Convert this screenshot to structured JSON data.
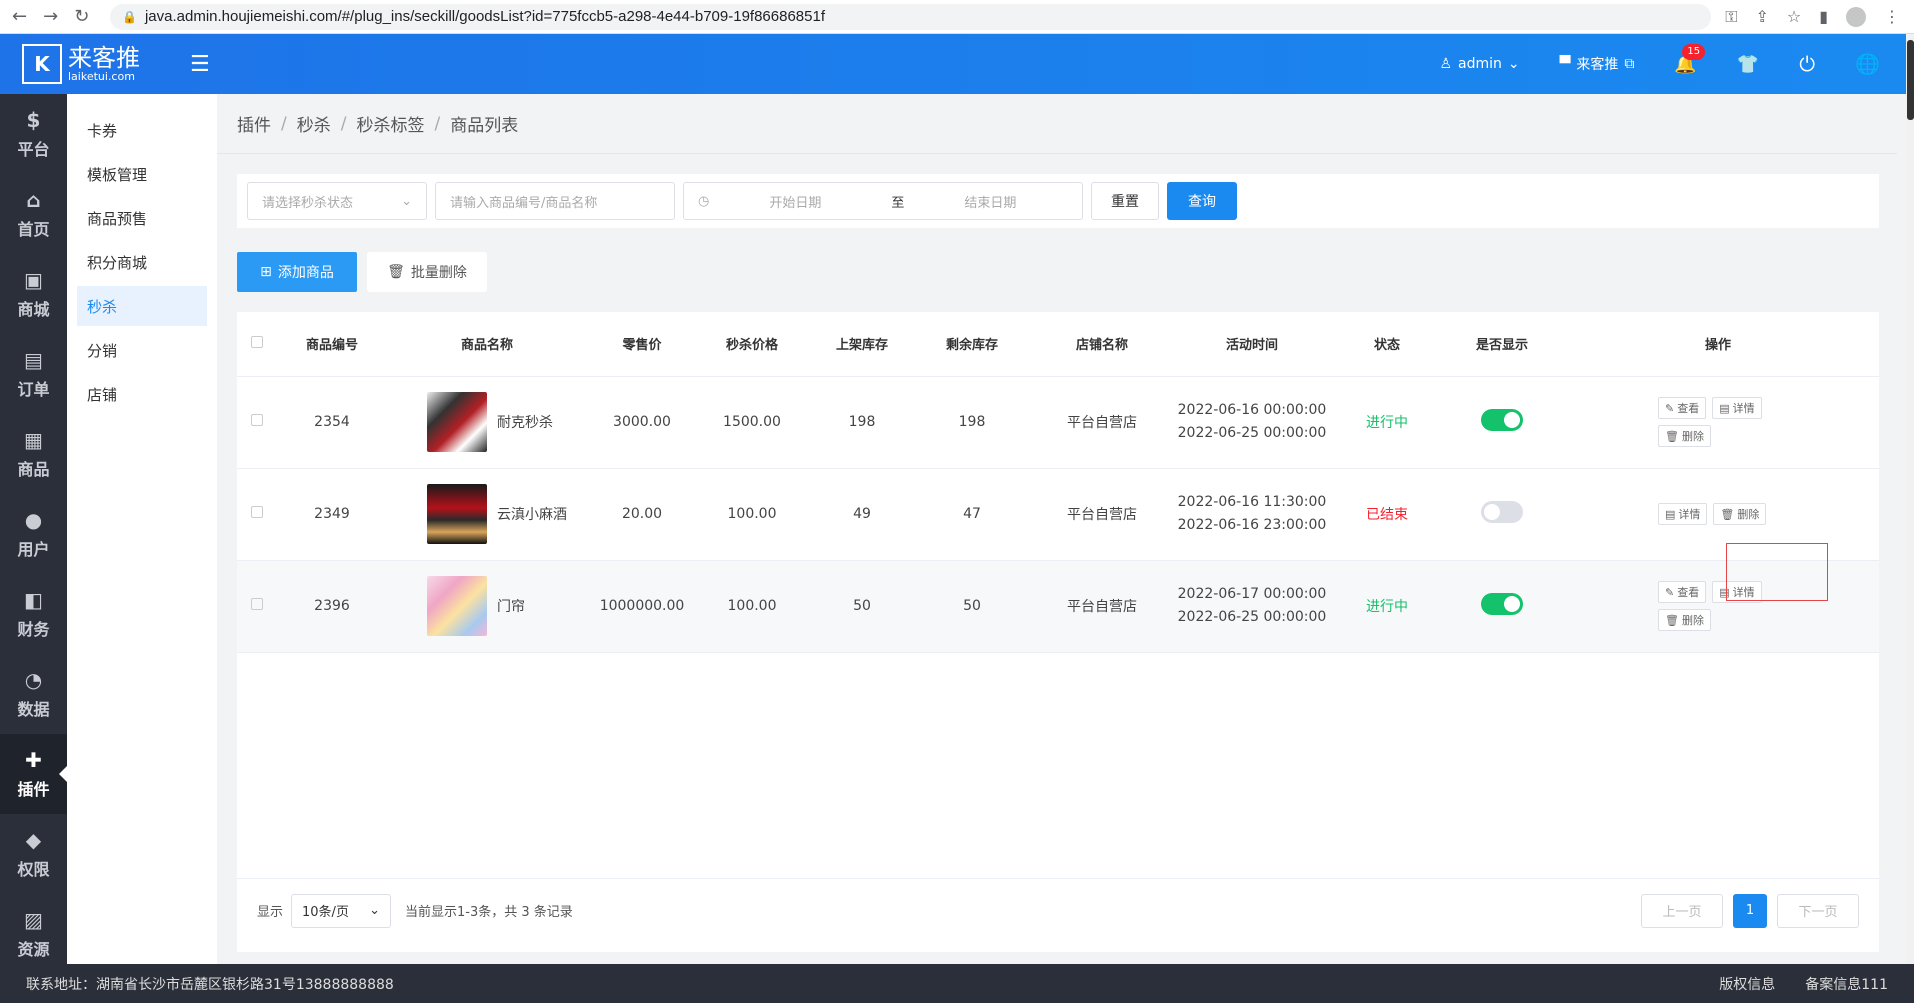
{
  "browser": {
    "url": "java.admin.houjiemeishi.com/#/plug_ins/seckill/goodsList?id=775fccb5-a298-4e44-b709-19f86686851f"
  },
  "header": {
    "logo_main": "来客推",
    "logo_sub": "laiketui.com",
    "user": "admin",
    "shop": "来客推",
    "notification_count": "15"
  },
  "rail": [
    {
      "label": "平台",
      "icon": "$"
    },
    {
      "label": "首页",
      "icon": "⌂"
    },
    {
      "label": "商城",
      "icon": "▣"
    },
    {
      "label": "订单",
      "icon": "▤"
    },
    {
      "label": "商品",
      "icon": "▦"
    },
    {
      "label": "用户",
      "icon": "●"
    },
    {
      "label": "财务",
      "icon": "◧"
    },
    {
      "label": "数据",
      "icon": "◔"
    },
    {
      "label": "插件",
      "icon": "✚"
    },
    {
      "label": "权限",
      "icon": "◆"
    },
    {
      "label": "资源",
      "icon": "▨"
    }
  ],
  "subnav": [
    "卡券",
    "模板管理",
    "商品预售",
    "积分商城",
    "秒杀",
    "分销",
    "店铺"
  ],
  "breadcrumb": [
    "插件",
    "秒杀",
    "秒杀标签",
    "商品列表"
  ],
  "filter": {
    "status_placeholder": "请选择秒杀状态",
    "keyword_placeholder": "请输入商品编号/商品名称",
    "start_placeholder": "开始日期",
    "range_sep": "至",
    "end_placeholder": "结束日期",
    "reset_label": "重置",
    "query_label": "查询"
  },
  "actions": {
    "add_label": "添加商品",
    "batch_delete_label": "批量删除"
  },
  "table": {
    "columns": [
      "商品编号",
      "商品名称",
      "零售价",
      "秒杀价格",
      "上架库存",
      "剩余库存",
      "店铺名称",
      "活动时间",
      "状态",
      "是否显示",
      "操作"
    ],
    "rows": [
      {
        "id": "2354",
        "name": "耐克秒杀",
        "retail": "3000.00",
        "seckill": "1500.00",
        "stock": "198",
        "remain": "198",
        "shop": "平台自营店",
        "start": "2022-06-16 00:00:00",
        "end": "2022-06-25 00:00:00",
        "status": "进行中",
        "shown": true
      },
      {
        "id": "2349",
        "name": "云滇小麻酒",
        "retail": "20.00",
        "seckill": "100.00",
        "stock": "49",
        "remain": "47",
        "shop": "平台自营店",
        "start": "2022-06-16 11:30:00",
        "end": "2022-06-16 23:00:00",
        "status": "已结束",
        "shown": false
      },
      {
        "id": "2396",
        "name": "门帘",
        "retail": "1000000.00",
        "seckill": "100.00",
        "stock": "50",
        "remain": "50",
        "shop": "平台自营店",
        "start": "2022-06-17 00:00:00",
        "end": "2022-06-25 00:00:00",
        "status": "进行中",
        "shown": true
      }
    ],
    "op_view": "查看",
    "op_detail": "详情",
    "op_delete": "删除"
  },
  "pager": {
    "show_label": "显示",
    "page_size": "10条/页",
    "summary": "当前显示1-3条，共 3 条记录",
    "prev": "上一页",
    "current": "1",
    "next": "下一页"
  },
  "footer": {
    "address": "联系地址：湖南省长沙市岳麓区银杉路31号13888888888",
    "copyright": "版权信息",
    "record": "备案信息111"
  },
  "colors": {
    "primary": "#1a8af0",
    "success": "#19be6b",
    "danger": "#f5222d",
    "rail_bg": "#2b2f3a"
  }
}
